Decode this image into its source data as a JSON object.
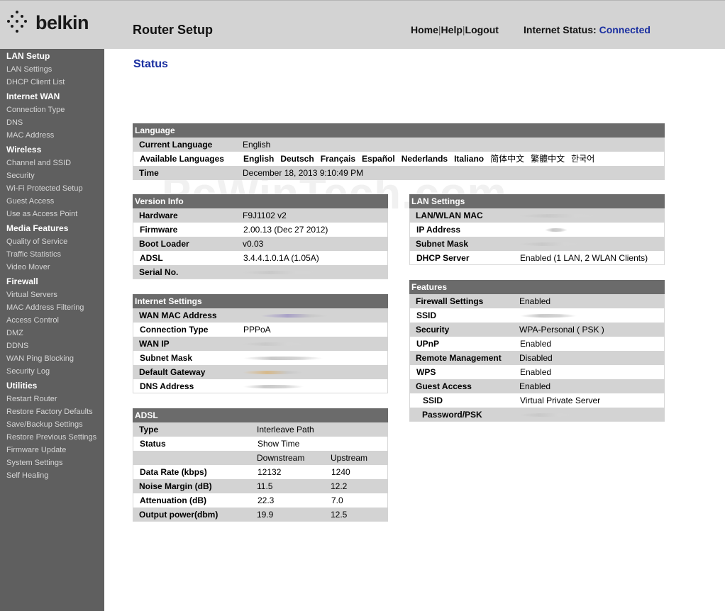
{
  "brand": "belkin",
  "header": {
    "title": "Router Setup",
    "links": {
      "home": "Home",
      "help": "Help",
      "logout": "Logout",
      "sep": "|"
    },
    "status_label": "Internet Status:",
    "status_value": "Connected",
    "status_color": "#1a2fa0",
    "bg": "#d3d3d3"
  },
  "watermark": "PcWinTech.com",
  "sidebar": {
    "bg": "#5f5f5f",
    "sections": [
      {
        "title": "LAN Setup",
        "items": [
          "LAN Settings",
          "DHCP Client List"
        ]
      },
      {
        "title": "Internet WAN",
        "items": [
          "Connection Type",
          "DNS",
          "MAC Address"
        ]
      },
      {
        "title": "Wireless",
        "items": [
          "Channel and SSID",
          "Security",
          "Wi-Fi Protected Setup",
          "Guest Access",
          "Use as Access Point"
        ]
      },
      {
        "title": "Media Features",
        "items": [
          "Quality of Service",
          "Traffic Statistics",
          "Video Mover"
        ]
      },
      {
        "title": "Firewall",
        "items": [
          "Virtual Servers",
          "MAC Address Filtering",
          "Access Control",
          "DMZ",
          "DDNS",
          "WAN Ping Blocking",
          "Security Log"
        ]
      },
      {
        "title": "Utilities",
        "items": [
          "Restart Router",
          "Restore Factory Defaults",
          "Save/Backup Settings",
          "Restore Previous Settings",
          "Firmware Update",
          "System Settings",
          "Self Healing"
        ]
      }
    ]
  },
  "page_title": "Status",
  "language": {
    "header": "Language",
    "current_label": "Current Language",
    "current_value": "English",
    "available_label": "Available Languages",
    "languages": [
      "English",
      "Deutsch",
      "Français",
      "Español",
      "Nederlands",
      "Italiano",
      "简体中文",
      "繁體中文",
      "한국어"
    ],
    "time_label": "Time",
    "time_value": "December 18, 2013  9:10:49 PM"
  },
  "version_info": {
    "header": "Version Info",
    "rows": [
      {
        "label": "Hardware",
        "value": "F9J1102 v2"
      },
      {
        "label": "Firmware",
        "value": "2.00.13 (Dec 27 2012)"
      },
      {
        "label": "Boot Loader",
        "value": "v0.03"
      },
      {
        "label": "ADSL",
        "value": "3.4.4.1.0.1A (1.05A)"
      },
      {
        "label": "Serial No.",
        "value": ""
      }
    ]
  },
  "lan_settings": {
    "header": "LAN Settings",
    "rows": [
      {
        "label": "LAN/WLAN MAC",
        "value": ""
      },
      {
        "label": "IP Address",
        "value": ""
      },
      {
        "label": "Subnet Mask",
        "value": ""
      },
      {
        "label": "DHCP Server",
        "value": "Enabled (1 LAN, 2 WLAN Clients)"
      }
    ]
  },
  "internet_settings": {
    "header": "Internet Settings",
    "rows": [
      {
        "label": "WAN MAC Address",
        "value": ""
      },
      {
        "label": "Connection Type",
        "value": "PPPoA"
      },
      {
        "label": "WAN IP",
        "value": ""
      },
      {
        "label": "Subnet Mask",
        "value": ""
      },
      {
        "label": "Default Gateway",
        "value": ""
      },
      {
        "label": "DNS Address",
        "value": ""
      }
    ]
  },
  "features": {
    "header": "Features",
    "rows": [
      {
        "label": "Firewall Settings",
        "value": "Enabled"
      },
      {
        "label": "SSID",
        "value": ""
      },
      {
        "label": "Security",
        "value": "WPA-Personal ( PSK )"
      },
      {
        "label": "UPnP",
        "value": "Enabled"
      },
      {
        "label": "Remote Management",
        "value": "Disabled"
      },
      {
        "label": "WPS",
        "value": "Enabled"
      },
      {
        "label": "Guest Access",
        "value": "Enabled"
      },
      {
        "label": "SSID",
        "value": "Virtual Private Server"
      },
      {
        "label": "Password/PSK",
        "value": ""
      }
    ]
  },
  "adsl": {
    "header": "ADSL",
    "type_label": "Type",
    "type_value": "Interleave Path",
    "status_label": "Status",
    "status_value": "Show Time",
    "col_down": "Downstream",
    "col_up": "Upstream",
    "rows": [
      {
        "label": "Data Rate (kbps)",
        "down": "12132",
        "up": "1240"
      },
      {
        "label": "Noise Margin (dB)",
        "down": "11.5",
        "up": "12.2"
      },
      {
        "label": "Attenuation (dB)",
        "down": "22.3",
        "up": "7.0"
      },
      {
        "label": "Output power(dbm)",
        "down": "19.9",
        "up": "12.5"
      }
    ]
  }
}
